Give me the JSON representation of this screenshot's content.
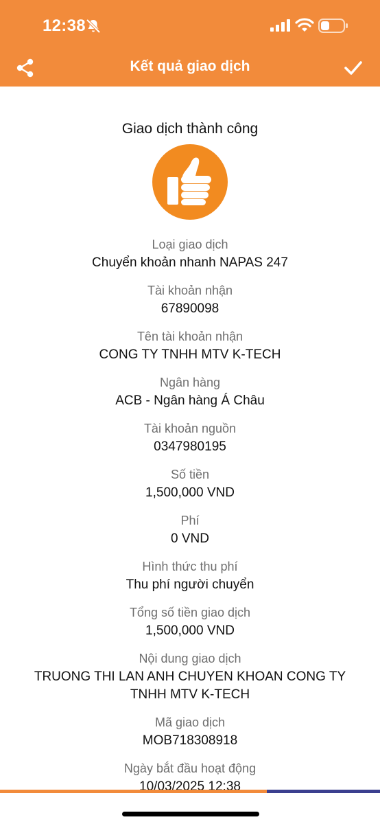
{
  "status": {
    "time": "12:38"
  },
  "header": {
    "title": "Kết quả giao dịch"
  },
  "result": {
    "title": "Giao dịch thành công"
  },
  "fields": [
    {
      "label": "Loại giao dịch",
      "value": "Chuyển khoản nhanh NAPAS 247"
    },
    {
      "label": "Tài khoản nhận",
      "value": "67890098"
    },
    {
      "label": "Tên tài khoản nhận",
      "value": "CONG TY TNHH MTV K-TECH"
    },
    {
      "label": "Ngân hàng",
      "value": "ACB - Ngân hàng Á Châu"
    },
    {
      "label": "Tài khoản nguồn",
      "value": "0347980195"
    },
    {
      "label": "Số tiền",
      "value": "1,500,000 VND"
    },
    {
      "label": "Phí",
      "value": "0 VND"
    },
    {
      "label": "Hình thức thu phí",
      "value": "Thu phí người chuyển"
    },
    {
      "label": "Tổng số tiền giao dịch",
      "value": "1,500,000 VND"
    },
    {
      "label": "Nội dung giao dịch",
      "value": "TRUONG THI LAN ANH CHUYEN KHOAN CONG TY TNHH MTV K-TECH"
    },
    {
      "label": "Mã giao dịch",
      "value": "MOB718308918"
    },
    {
      "label": "Ngày bắt đầu hoạt động",
      "value": "10/03/2025 12:38"
    }
  ],
  "colors": {
    "accent": "#F28B3B",
    "thumb": "#F28B20",
    "secondary_bar": "#3B3F8F"
  },
  "icons": [
    "bell-slash-icon",
    "signal-icon",
    "wifi-icon",
    "battery-icon",
    "share-icon",
    "checkmark-icon",
    "thumbs-up-icon"
  ]
}
